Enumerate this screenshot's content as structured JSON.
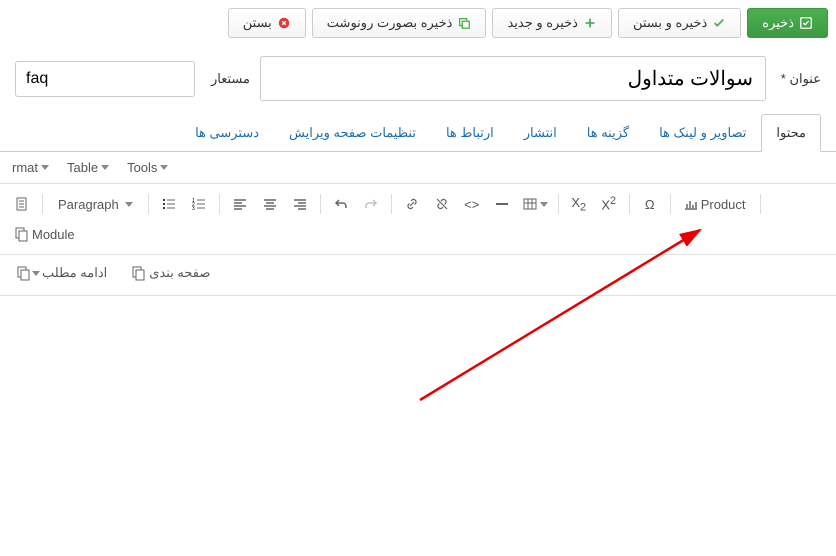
{
  "toolbar": {
    "save": "ذخیره",
    "save_close": "ذخیره و بستن",
    "save_new": "ذخیره و جدید",
    "save_copy": "ذخیره بصورت رونوشت",
    "close": "بستن"
  },
  "form": {
    "title_label": "عنوان",
    "title_value": "سوالات متداول",
    "alias_label": "مستعار",
    "alias_value": "faq"
  },
  "tabs": {
    "content": "محتوا",
    "images": "تصاویر و لینک ها",
    "options": "گزینه ها",
    "publish": "انتشار",
    "assoc": "ارتباط ها",
    "editconfig": "تنظیمات صفحه ویرایش",
    "permissions": "دسترسی ها"
  },
  "menubar": {
    "format": "rmat",
    "table": "Table",
    "tools": "Tools"
  },
  "editor": {
    "paragraph": "Paragraph",
    "product": "Product",
    "module": "Module",
    "readmore": "ادامه مطلب",
    "pagebreak": "صفحه بندی"
  }
}
